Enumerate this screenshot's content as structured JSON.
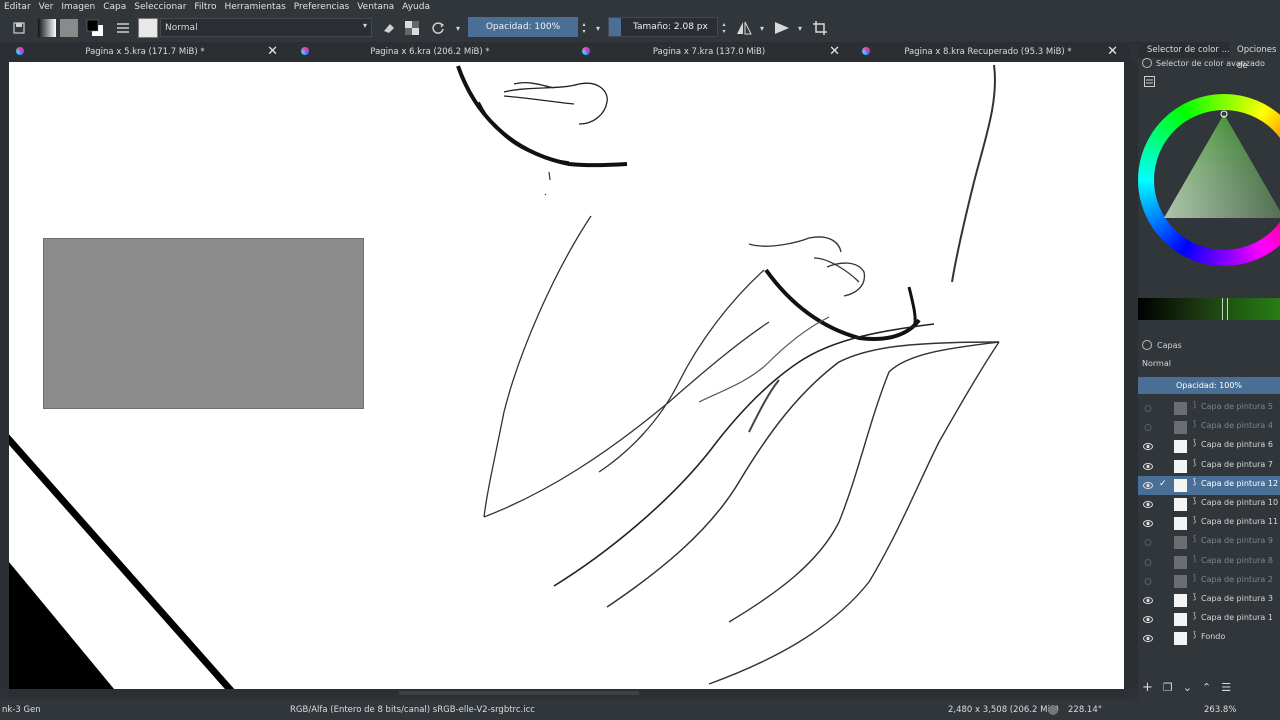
{
  "menu": [
    "Editar",
    "Ver",
    "Imagen",
    "Capa",
    "Seleccionar",
    "Filtro",
    "Herramientas",
    "Preferencias",
    "Ventana",
    "Ayuda"
  ],
  "toolbar": {
    "blend_mode": "Normal",
    "opacity_label": "Opacidad: 100%",
    "size_label": "Tamaño: 2.08 px"
  },
  "tabs": [
    {
      "title": "Pagina x 5.kra (171.7 MiB) *"
    },
    {
      "title": "Pagina x 6.kra (206.2 MiB) *"
    },
    {
      "title": "Pagina x 7.kra (137.0 MiB)"
    },
    {
      "title": "Pagina x 8.kra Recuperado (95.3 MiB) *"
    }
  ],
  "docker": {
    "tab1": "Selector de color ...",
    "tab2": "Opciones de",
    "color_selector_title": "Selector de color avanzado",
    "layers_title": "Capas",
    "layers_blend": "Normal",
    "layers_opacity": "Opacidad:  100%",
    "layers": [
      {
        "name": "Capa de pintura 5",
        "visible": false
      },
      {
        "name": "Capa de pintura 4",
        "visible": false
      },
      {
        "name": "Capa de pintura 6",
        "visible": true
      },
      {
        "name": "Capa de pintura 7",
        "visible": true
      },
      {
        "name": "Capa de pintura 12",
        "visible": true,
        "selected": true
      },
      {
        "name": "Capa de pintura 10",
        "visible": true
      },
      {
        "name": "Capa de pintura 11",
        "visible": true
      },
      {
        "name": "Capa de pintura 9",
        "visible": false
      },
      {
        "name": "Capa de pintura 8",
        "visible": false
      },
      {
        "name": "Capa de pintura 2",
        "visible": false
      },
      {
        "name": "Capa de pintura 3",
        "visible": true
      },
      {
        "name": "Capa de pintura 1",
        "visible": true
      },
      {
        "name": "Fondo",
        "visible": true
      }
    ]
  },
  "status": {
    "brush": "nk-3 Gen",
    "color_space": "RGB/Alfa (Entero de 8 bits/canal)  sRGB-elle-V2-srgbtrc.icc",
    "dimensions": "2,480 x 3,508 (206.2 MiB)",
    "rotation": "228.14°",
    "zoom": "263.8%"
  },
  "colors": {
    "accent": "#4a6f96",
    "panel": "#31363b",
    "canvas": "#ffffff"
  }
}
